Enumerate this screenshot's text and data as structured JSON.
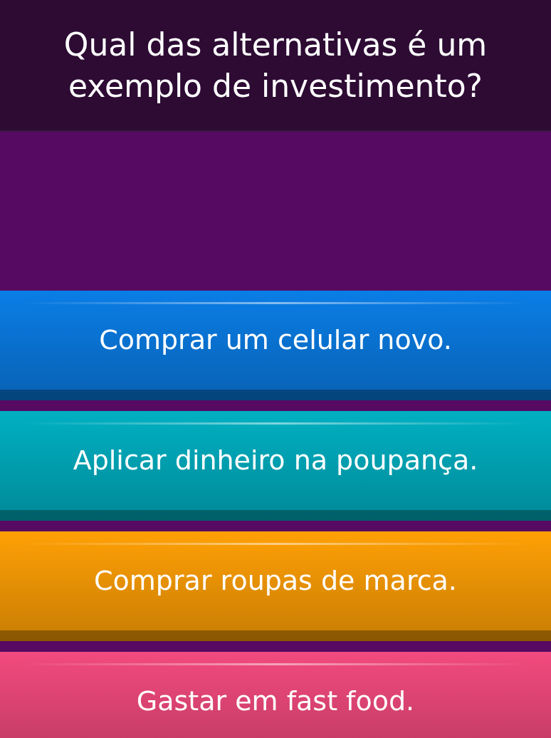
{
  "question": "Qual das alternativas é um exemplo de investimento?",
  "answers": [
    {
      "label": "Comprar um celular novo.",
      "color": "#0a7de6"
    },
    {
      "label": "Aplicar dinheiro na poupança.",
      "color": "#00b0c2"
    },
    {
      "label": "Comprar roupas de marca.",
      "color": "#ffa005"
    },
    {
      "label": "Gastar em fast food.",
      "color": "#f24a7e"
    }
  ]
}
